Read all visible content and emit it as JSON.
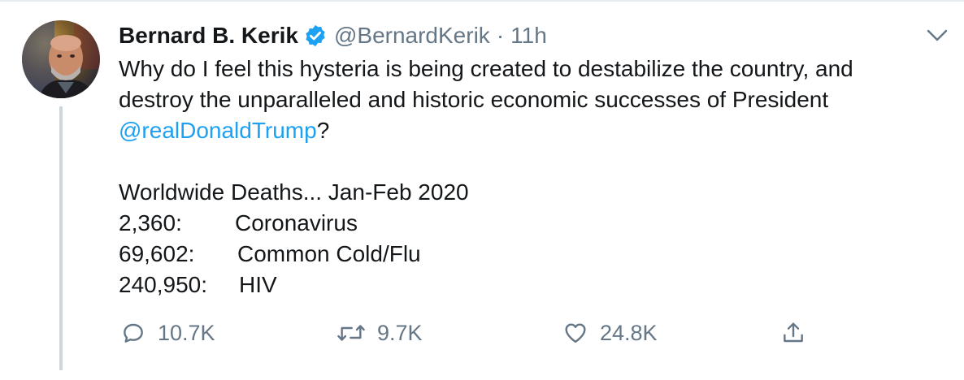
{
  "author": {
    "display_name": "Bernard B. Kerik",
    "handle": "@BernardKerik",
    "separator": "·",
    "time": "11h",
    "verified": true
  },
  "body": {
    "line1": "Why do I feel this hysteria is being created to destabilize the country, and",
    "line2": "destroy the unparalleled and historic economic successes of President",
    "mention": "@realDonaldTrump",
    "mention_suffix": "?",
    "stats_title": "Worldwide Deaths... Jan-Feb 2020",
    "stats": [
      {
        "value": "2,360:",
        "label": "Coronavirus"
      },
      {
        "value": "69,602:",
        "label": "Common Cold/Flu"
      },
      {
        "value": "240,950:",
        "label": "HIV"
      }
    ]
  },
  "actions": {
    "reply_count": "10.7K",
    "retweet_count": "9.7K",
    "like_count": "24.8K"
  },
  "icons": {
    "reply": "reply-icon",
    "retweet": "retweet-icon",
    "like": "like-icon",
    "share": "share-icon",
    "menu": "chevron-down-icon",
    "verified": "verified-badge-icon"
  },
  "colors": {
    "text": "#14171a",
    "secondary": "#657786",
    "link": "#1da1f2",
    "thread_line": "#ccd6dd"
  }
}
